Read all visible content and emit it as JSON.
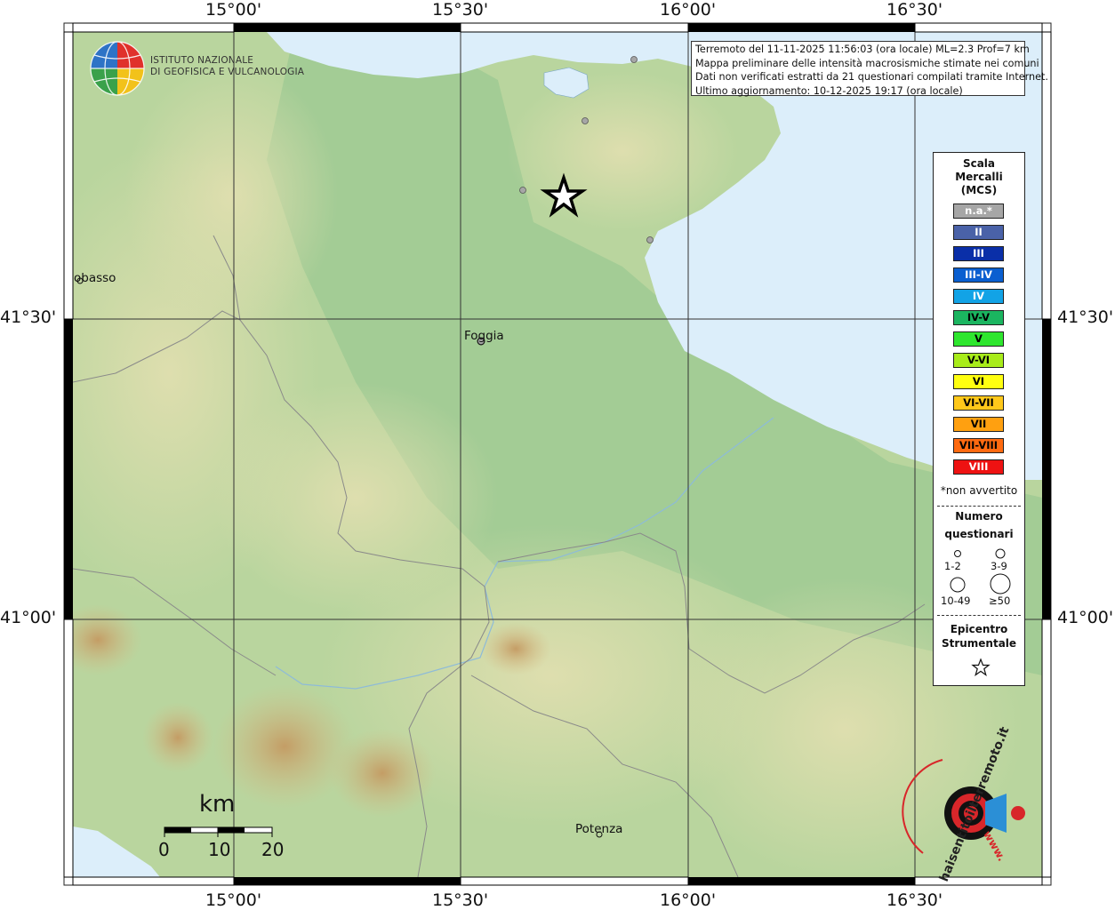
{
  "info": {
    "line1": "Terremoto del 11-11-2025 11:56:03 (ora locale) ML=2.3 Prof=7 km",
    "line2": "Mappa preliminare delle intensità macrosismiche stimate nei comuni",
    "line3": "Dati non verificati estratti da 21 questionari compilati tramite Internet.",
    "line4": "Ultimo aggiornamento: 10-12-2025 19:17 (ora locale)"
  },
  "institute": {
    "line1": "ISTITUTO NAZIONALE",
    "line2": "DI GEOFISICA E VULCANOLOGIA"
  },
  "axes": {
    "top": [
      "15°00'",
      "15°30'",
      "16°00'",
      "16°30'"
    ],
    "bottom": [
      "15°00'",
      "15°30'",
      "16°00'",
      "16°30'"
    ],
    "left": [
      "41°30'",
      "41°00'"
    ],
    "right": [
      "41°30'",
      "41°00'"
    ]
  },
  "cities": {
    "foggia": "Foggia",
    "campobasso": "obasso",
    "potenza": "Potenza"
  },
  "legend": {
    "title1": "Scala",
    "title2": "Mercalli",
    "title3": "(MCS)",
    "intensities": [
      {
        "label": "n.a.*",
        "color": "#a6a6a6",
        "text": "#ffffff"
      },
      {
        "label": "II",
        "color": "#4a62a8",
        "text": "#ffffff"
      },
      {
        "label": "III",
        "color": "#0a2fa8",
        "text": "#ffffff"
      },
      {
        "label": "III-IV",
        "color": "#0a5fd0",
        "text": "#ffffff"
      },
      {
        "label": "IV",
        "color": "#12a3e6",
        "text": "#ffffff"
      },
      {
        "label": "IV-V",
        "color": "#1bb560",
        "text": "#000000"
      },
      {
        "label": "V",
        "color": "#2ee62e",
        "text": "#000000"
      },
      {
        "label": "V-VI",
        "color": "#a8ec1a",
        "text": "#000000"
      },
      {
        "label": "VI",
        "color": "#ffff10",
        "text": "#000000"
      },
      {
        "label": "VI-VII",
        "color": "#ffc81a",
        "text": "#000000"
      },
      {
        "label": "VII",
        "color": "#ffa010",
        "text": "#000000"
      },
      {
        "label": "VII-VIII",
        "color": "#ff6a10",
        "text": "#000000"
      },
      {
        "label": "VIII",
        "color": "#ee1212",
        "text": "#ffffff"
      }
    ],
    "not_felt": "*non avvertito",
    "count_title1": "Numero",
    "count_title2": "questionari",
    "counts": [
      "1-2",
      "3-9",
      "10-49",
      "≥50"
    ],
    "epicenter1": "Epicentro",
    "epicenter2": "Strumentale"
  },
  "scale_bar": {
    "unit": "km",
    "ticks": [
      "0",
      "10",
      "20"
    ]
  },
  "badge": {
    "text": "haisentitoilterremoto.it",
    "www": "www."
  },
  "colors": {
    "sea": "#dceefa",
    "lowland": "#a9cf97",
    "hills": "#dcd8a2",
    "mountains": "#c9a06a",
    "grid": "#333333"
  }
}
